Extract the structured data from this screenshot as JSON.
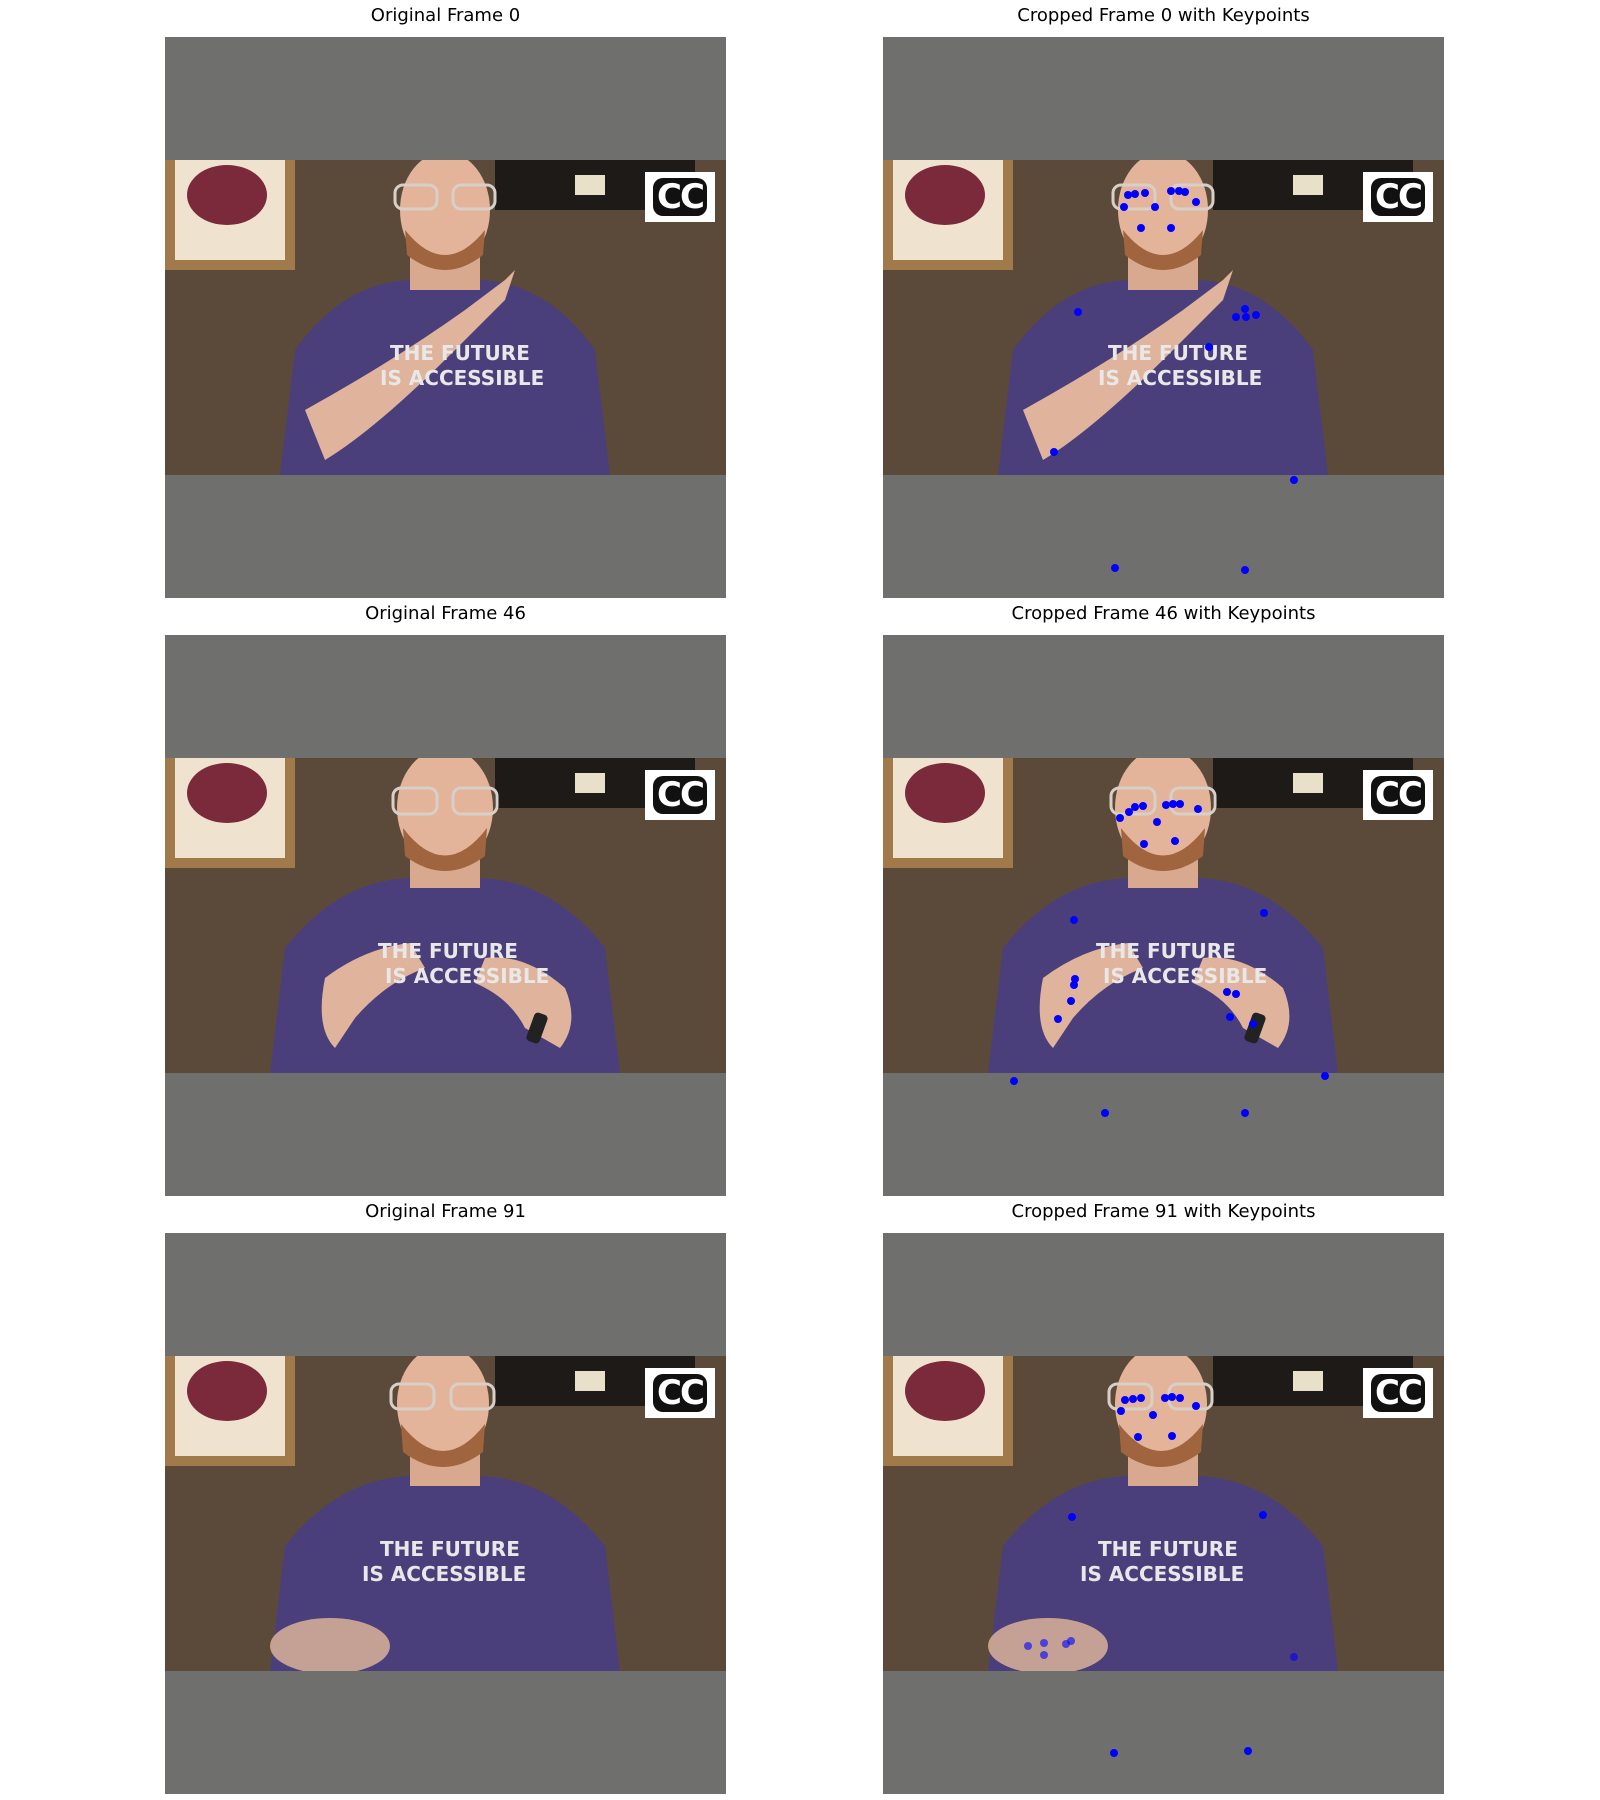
{
  "panels": [
    {
      "title": "Original Frame 0",
      "shirt_text": [
        "THE FUTURE",
        "IS ACCESSIBLE"
      ],
      "cc": "CC"
    },
    {
      "title": "Cropped Frame 0 with Keypoints",
      "shirt_text": [
        "THE FUTURE",
        "IS ACCESSIBLE"
      ],
      "cc": "CC"
    },
    {
      "title": "Original Frame 46",
      "shirt_text": [
        "THE FUTURE",
        "IS ACCESSIBLE"
      ],
      "cc": "CC"
    },
    {
      "title": "Cropped Frame 46 with Keypoints",
      "shirt_text": [
        "THE FUTURE",
        "IS ACCESSIBLE"
      ],
      "cc": "CC"
    },
    {
      "title": "Original Frame 91",
      "shirt_text": [
        "THE FUTURE",
        "IS ACCESSIBLE"
      ],
      "cc": "CC"
    },
    {
      "title": "Cropped Frame 91 with Keypoints",
      "shirt_text": [
        "THE FUTURE",
        "IS ACCESSIBLE"
      ],
      "cc": "CC"
    }
  ],
  "colors": {
    "padding_gray": "#6f706e",
    "wall": "#5b4a3a",
    "shirt": "#4a3f7a",
    "skin": "#e3b39a",
    "keypoint": "#0000ff"
  }
}
